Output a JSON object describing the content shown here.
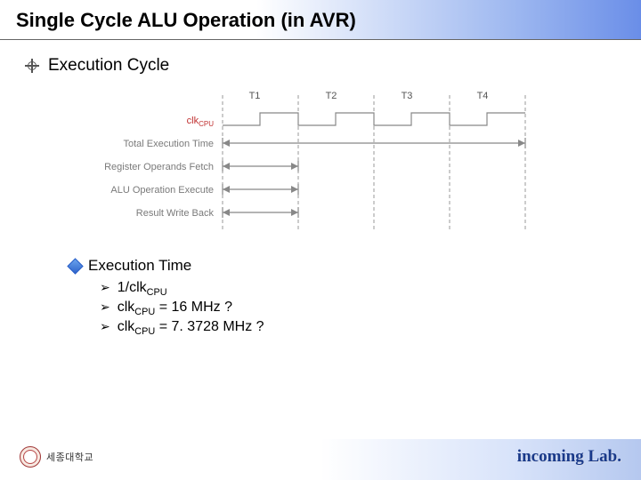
{
  "title": "Single Cycle ALU Operation (in AVR)",
  "section": {
    "heading": "Execution Cycle"
  },
  "diagram": {
    "ticks": [
      "T1",
      "T2",
      "T3",
      "T4"
    ],
    "rows": [
      {
        "label_html": "clk",
        "sub": "CPU",
        "red": true
      },
      {
        "label": "Total Execution Time"
      },
      {
        "label": "Register Operands Fetch"
      },
      {
        "label": "ALU Operation Execute"
      },
      {
        "label": "Result Write Back"
      }
    ]
  },
  "subsection": {
    "heading": "Execution Time",
    "items": [
      {
        "pre": " 1/clk",
        "sub": "CPU",
        "post": ""
      },
      {
        "pre": "clk",
        "sub": "CPU",
        "post": " = 16 MHz ?"
      },
      {
        "pre": "clk",
        "sub": "CPU",
        "post": " = 7. 3728 MHz ?"
      }
    ]
  },
  "footer": {
    "university": "세종대학교",
    "lab": "incoming Lab."
  }
}
